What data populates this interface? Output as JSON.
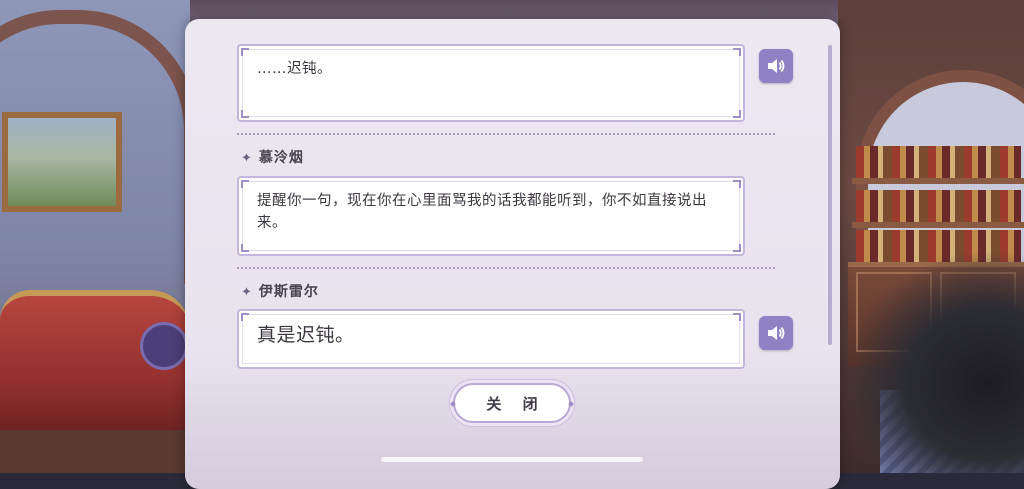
{
  "dialog": {
    "entries": [
      {
        "speaker": "",
        "text": "……迟钝。",
        "has_voice": true
      },
      {
        "speaker": "慕泠烟",
        "text": "提醒你一句，现在你在心里面骂我的话我都能听到，你不如直接说出来。",
        "has_voice": false
      },
      {
        "speaker": "伊斯雷尔",
        "text": "真是迟钝。",
        "has_voice": true
      }
    ],
    "close_label": "关 闭"
  },
  "icons": {
    "voice": "speaker-icon",
    "name_marker": "sparkle-icon"
  },
  "colors": {
    "panel_bg": "#ece8f2",
    "accent": "#8f82c4",
    "text": "#3c3740"
  }
}
